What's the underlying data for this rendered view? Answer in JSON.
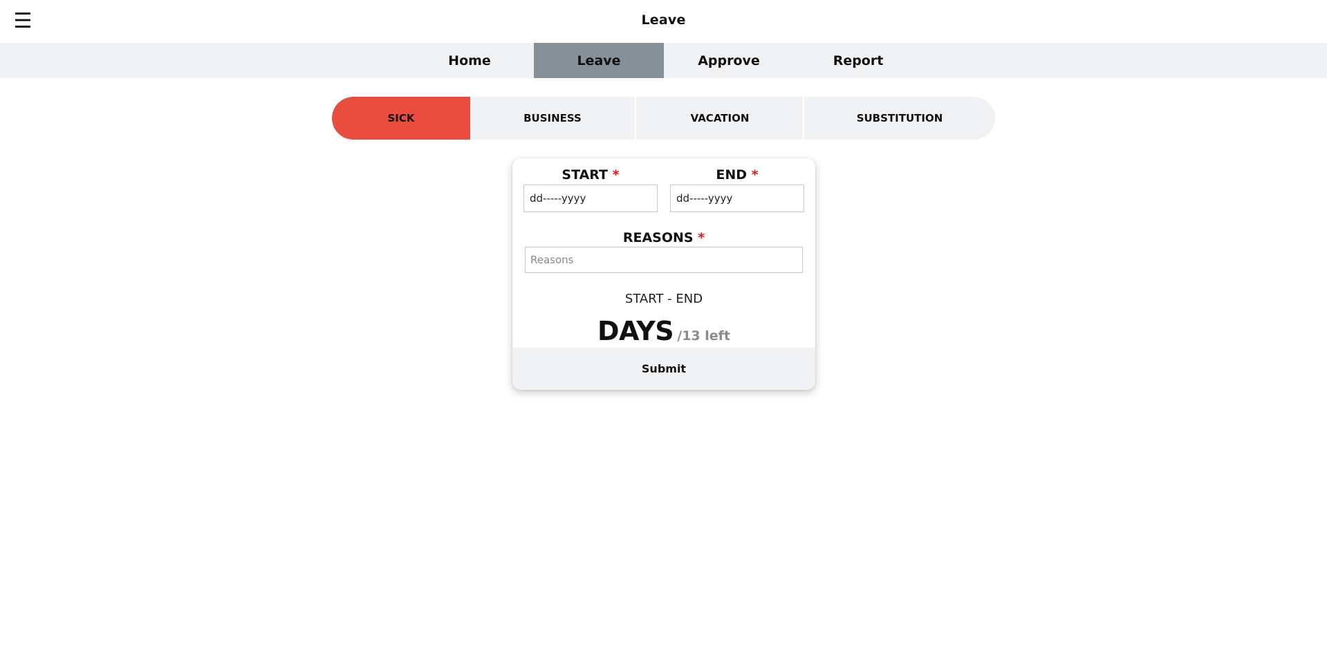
{
  "header": {
    "menu_icon": "hamburger-menu-icon",
    "title": "Leave"
  },
  "nav": {
    "tabs": [
      {
        "label": "Home",
        "active": false
      },
      {
        "label": "Leave",
        "active": true
      },
      {
        "label": "Approve",
        "active": false
      },
      {
        "label": "Report",
        "active": false
      }
    ],
    "active_color": "#859099",
    "bar_color": "#f1f2f4"
  },
  "leave_types": {
    "items": [
      {
        "label": "SICK",
        "selected": true
      },
      {
        "label": "BUSINESS",
        "selected": false
      },
      {
        "label": "VACATION",
        "selected": false
      },
      {
        "label": "SUBSTITUTION",
        "selected": false
      }
    ],
    "selected_color": "#e84d40"
  },
  "form": {
    "start_label": "START",
    "end_label": "END",
    "required_mark": "*",
    "start_value": "dd-----yyyy",
    "end_value": "dd-----yyyy",
    "reasons_label": "REASONS",
    "reasons_placeholder": "Reasons",
    "range_text": "START - END",
    "days_label": "DAYS",
    "days_left": "/13 left",
    "submit_label": "Submit"
  }
}
